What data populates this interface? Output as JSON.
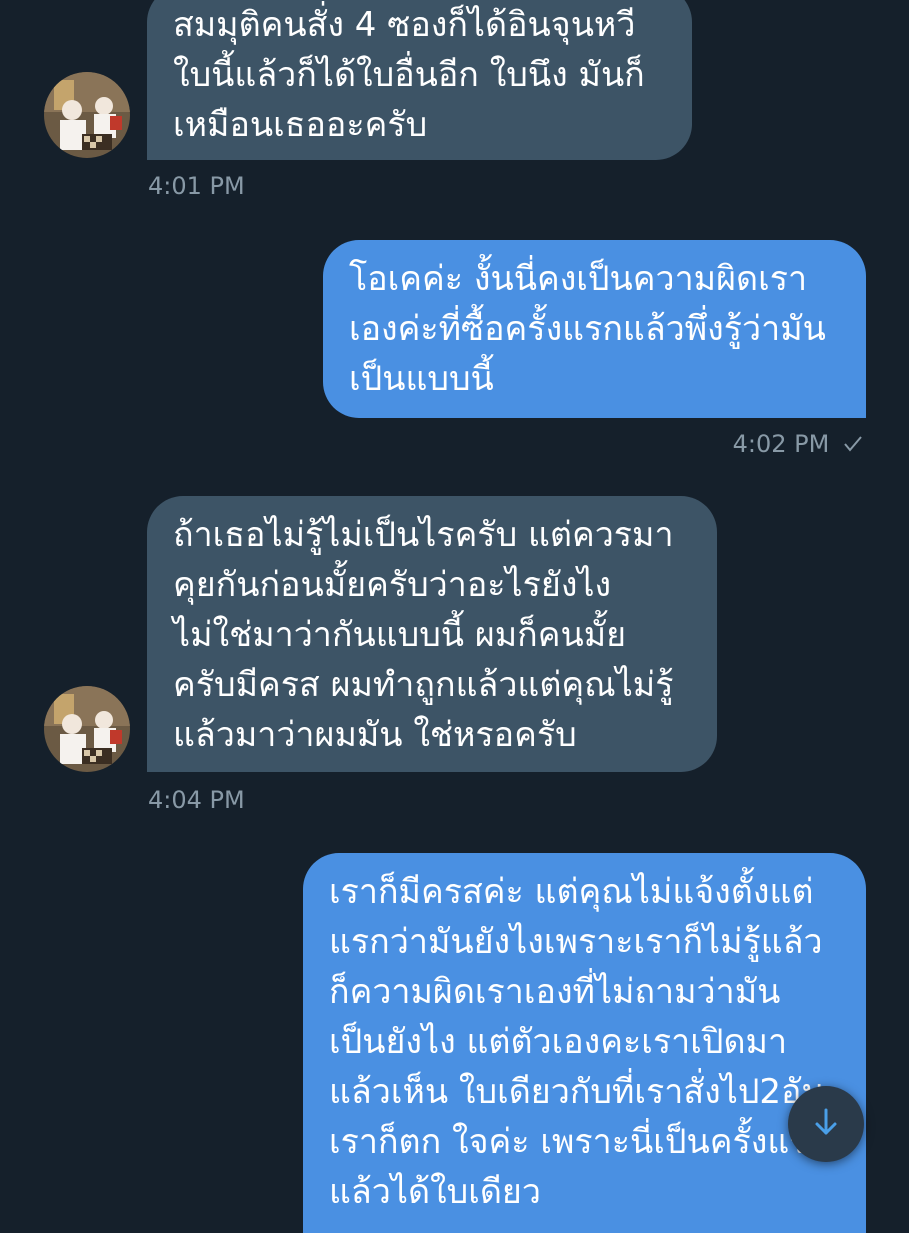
{
  "colors": {
    "background": "#15202b",
    "incoming_bubble": "#3d5466",
    "outgoing_bubble": "#4a90e2",
    "timestamp": "#8899a6"
  },
  "messages": [
    {
      "side": "incoming",
      "lines": [
        "สมมุติคนสั่ง 4 ซองก็ได้อินจุนหวี",
        "ใบนี้แล้วก็ได้ใบอื่นอีก ใบนึง มันก็",
        "เหมือนเธออะครับ"
      ],
      "time": "4:01 PM"
    },
    {
      "side": "outgoing",
      "lines": [
        "โอเคค่ะ งั้นนี่คงเป็นความผิดเรา",
        "เองค่ะที่ซื้อครั้งแรกแล้วพึ่งรู้ว่ามัน",
        "เป็นแบบนี้"
      ],
      "time": "4:02 PM",
      "status_icon": "check-icon"
    },
    {
      "side": "incoming",
      "lines": [
        "ถ้าเธอไม่รู้ไม่เป็นไรครับ แต่ควรมา",
        "คุยกันก่อนมั้ยครับว่าอะไรยังไง",
        "ไม่ใช่มาว่ากันแบบนี้ ผมก็คนมั้ย",
        "ครับมีครส ผมทำถูกแล้วแต่คุณไม่รู้",
        "แล้วมาว่าผมมัน ใช่หรอครับ"
      ],
      "time": "4:04 PM"
    },
    {
      "side": "outgoing",
      "lines": [
        "เราก็มีครสค่ะ แต่คุณไม่แจ้งตั้งแต่",
        "แรกว่ามันยังไงเพราะเราก็ไม่รู้แล้ว",
        "ก็ความผิดเราเองที่ไม่ถามว่ามัน",
        "เป็นยังไง แต่ตัวเองคะเราเปิดมา",
        "แล้วเห็น ใบเดียวกับที่เราสั่งไป2อัน",
        "เราก็ตก ใจค่ะ เพราะนี่เป็นครั้งแรก",
        "แล้วได้ใบเดียว"
      ]
    }
  ],
  "scroll_button": {
    "icon": "arrow-down-icon"
  }
}
